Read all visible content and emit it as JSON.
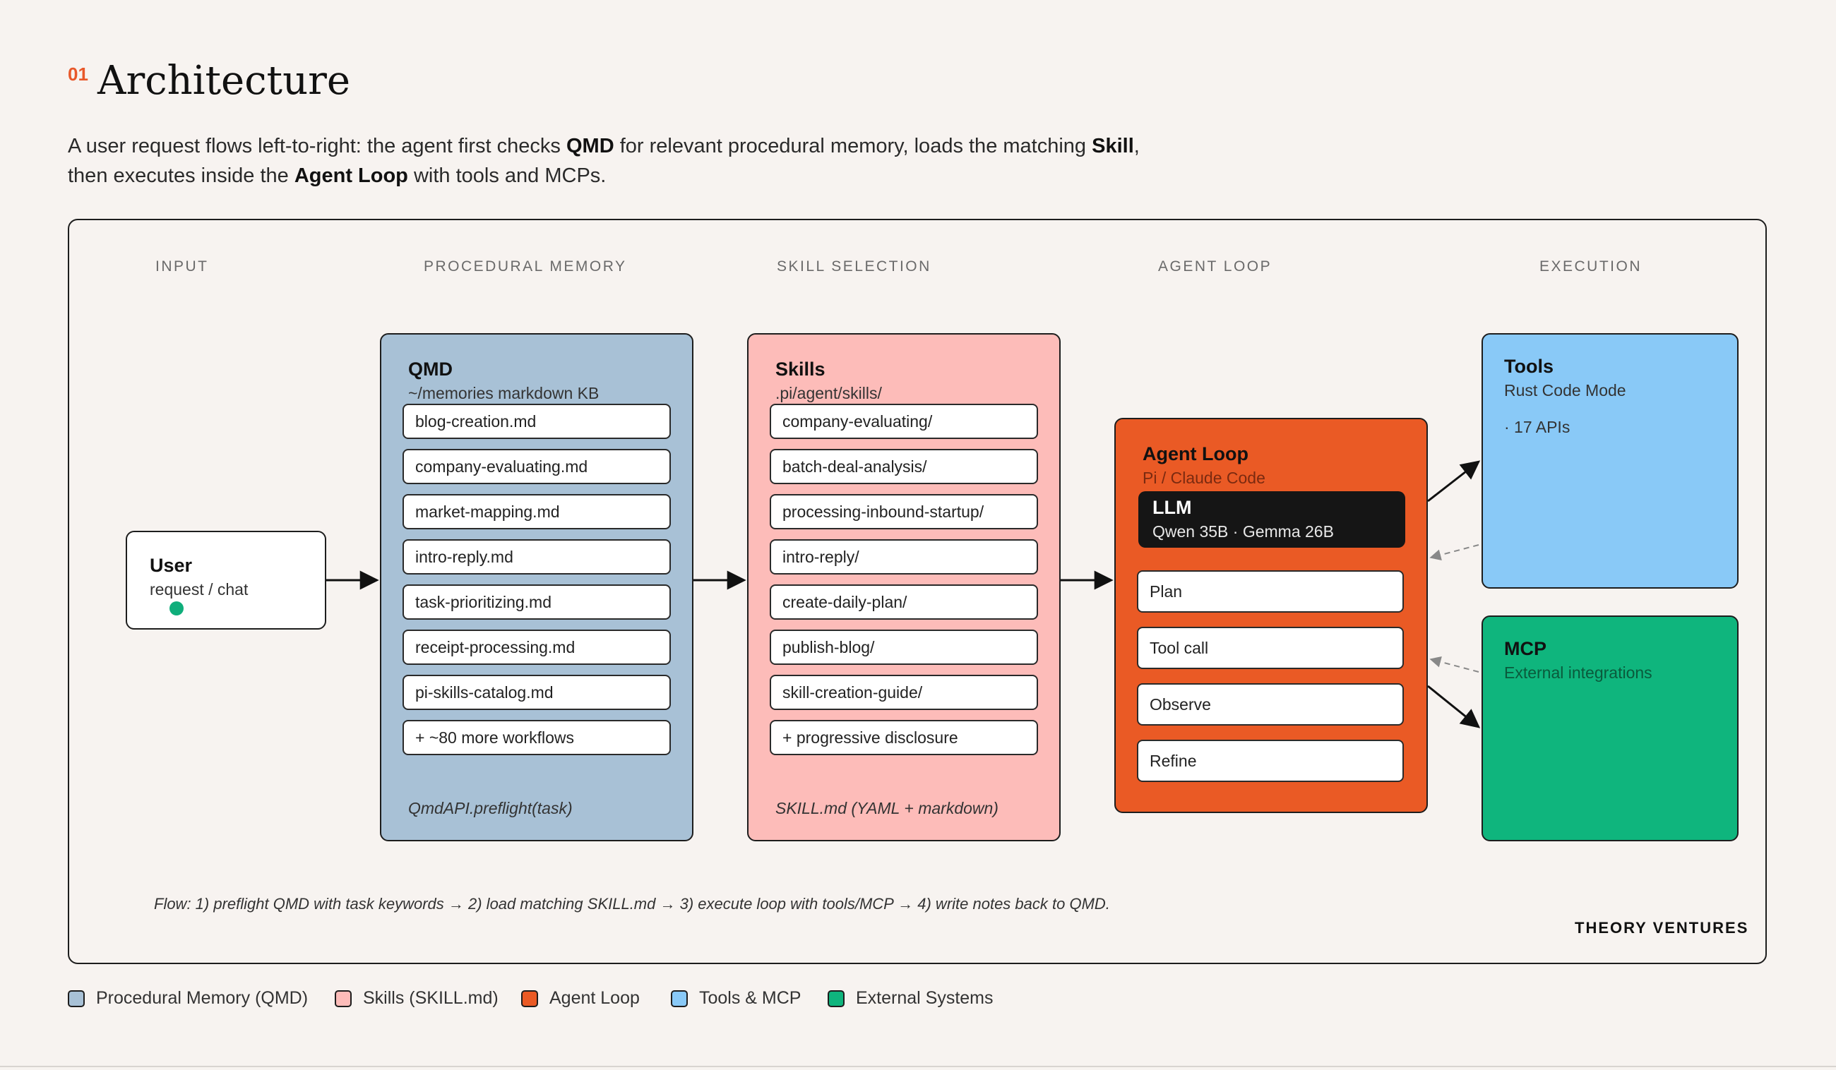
{
  "header": {
    "number": "01",
    "title": "Architecture",
    "intro_1": "A user request flows left-to-right: the agent first checks ",
    "intro_qmd": "QMD",
    "intro_2": " for relevant procedural memory, loads the matching ",
    "intro_skill": "Skill",
    "intro_3": ", then executes inside the ",
    "intro_loop": "Agent Loop",
    "intro_4": " with tools and MCPs."
  },
  "columns": [
    "INPUT",
    "PROCEDURAL MEMORY",
    "SKILL SELECTION",
    "AGENT LOOP",
    "EXECUTION"
  ],
  "user": {
    "title": "User",
    "sub": "request / chat"
  },
  "qmd": {
    "title": "QMD",
    "sub": "~/memories markdown KB",
    "items": [
      "blog-creation.md",
      "company-evaluating.md",
      "market-mapping.md",
      "intro-reply.md",
      "task-prioritizing.md",
      "receipt-processing.md",
      "pi-skills-catalog.md",
      "+ ~80 more workflows"
    ],
    "footer": "QmdAPI.preflight(task)"
  },
  "skills": {
    "title": "Skills",
    "sub": ".pi/agent/skills/",
    "items": [
      "company-evaluating/",
      "batch-deal-analysis/",
      "processing-inbound-startup/",
      "intro-reply/",
      "create-daily-plan/",
      "publish-blog/",
      "skill-creation-guide/",
      "+ progressive disclosure"
    ],
    "footer": "SKILL.md (YAML + markdown)"
  },
  "loop": {
    "title": "Agent Loop",
    "sub": "Pi / Claude Code",
    "llm_title": "LLM",
    "llm_sub": "Qwen 35B · Gemma 26B",
    "steps": [
      "Plan",
      "Tool call",
      "Observe",
      "Refine"
    ]
  },
  "tools": {
    "title": "Tools",
    "sub": "Rust Code Mode",
    "detail": "· 17 APIs"
  },
  "mcp": {
    "title": "MCP",
    "sub": "External integrations"
  },
  "flow_note": "Flow: 1) preflight QMD with task keywords → 2) load matching SKILL.md → 3) execute loop with tools/MCP → 4) write notes back to QMD.",
  "brand": "THEORY VENTURES",
  "legend": [
    {
      "label": "Procedural Memory (QMD)",
      "color": "#a8c1d6"
    },
    {
      "label": "Skills (SKILL.md)",
      "color": "#fdbcb9"
    },
    {
      "label": "Agent Loop",
      "color": "#ea5a25"
    },
    {
      "label": "Tools & MCP",
      "color": "#89c9f7"
    },
    {
      "label": "External Systems",
      "color": "#0fb57d"
    }
  ]
}
